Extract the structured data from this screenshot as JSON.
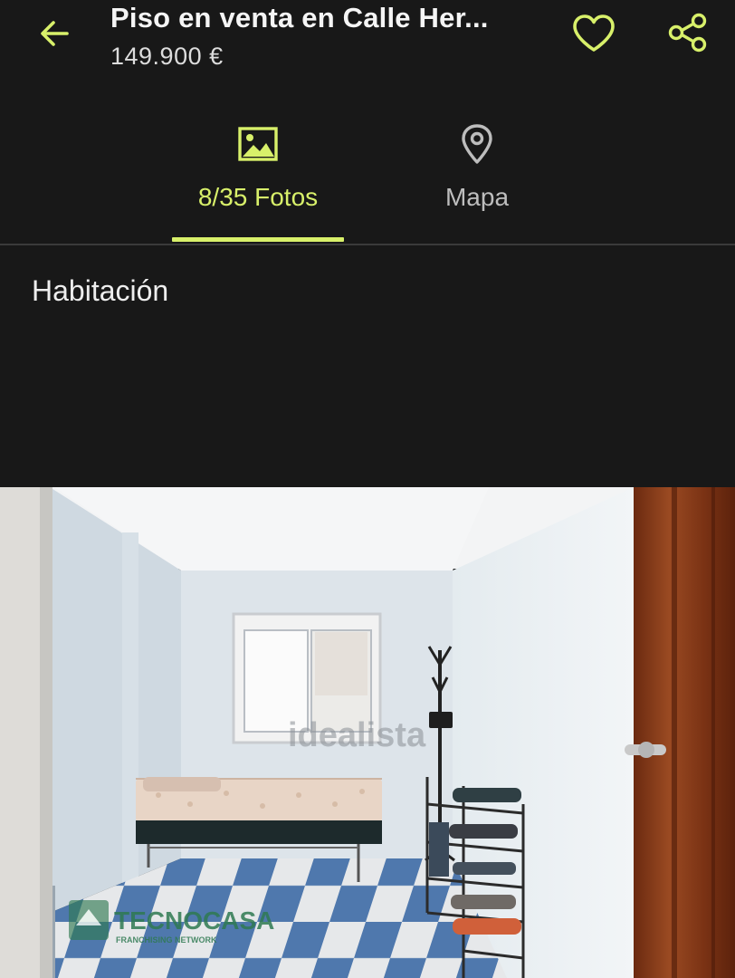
{
  "header": {
    "back_icon": "arrow-left-icon",
    "title": "Piso en venta en Calle Her...",
    "price": "149.900 €",
    "favorite_icon": "heart-icon",
    "share_icon": "share-icon"
  },
  "tabs": [
    {
      "label": "8/35 Fotos",
      "icon": "image-icon",
      "active": true
    },
    {
      "label": "Mapa",
      "icon": "map-pin-icon",
      "active": false
    }
  ],
  "gallery": {
    "caption": "Habitación",
    "watermark": "idealista",
    "agency_logo": "TECNOCASA",
    "agency_tagline": "FRANCHISING NETWORK"
  },
  "colors": {
    "background": "#181818",
    "accent": "#d8f06a",
    "inactive_text": "#bdbdbd",
    "divider": "#3a3a3a"
  }
}
